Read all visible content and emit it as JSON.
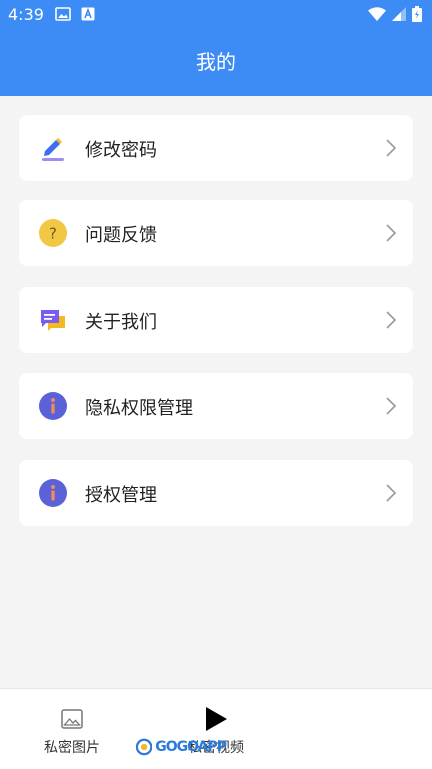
{
  "status": {
    "time": "4:39"
  },
  "header": {
    "title": "我的"
  },
  "menu": {
    "items": [
      {
        "label": "修改密码",
        "icon": "edit-pencil-icon"
      },
      {
        "label": "问题反馈",
        "icon": "question-icon"
      },
      {
        "label": "关于我们",
        "icon": "chat-bubbles-icon"
      },
      {
        "label": "隐私权限管理",
        "icon": "info-icon"
      },
      {
        "label": "授权管理",
        "icon": "info-icon"
      }
    ]
  },
  "bottom_nav": {
    "items": [
      {
        "label": "私密图片",
        "icon": "image-icon"
      },
      {
        "label": "私密视频",
        "icon": "play-icon"
      }
    ]
  },
  "watermark": {
    "text": "GOGOAPP"
  },
  "colors": {
    "header": "#3d8bf5",
    "background": "#f4f4f4",
    "question_yellow": "#f2c744",
    "info_purple": "#5b61d6",
    "chat_purple": "#7a5cf0",
    "chat_yellow": "#f5b823"
  }
}
